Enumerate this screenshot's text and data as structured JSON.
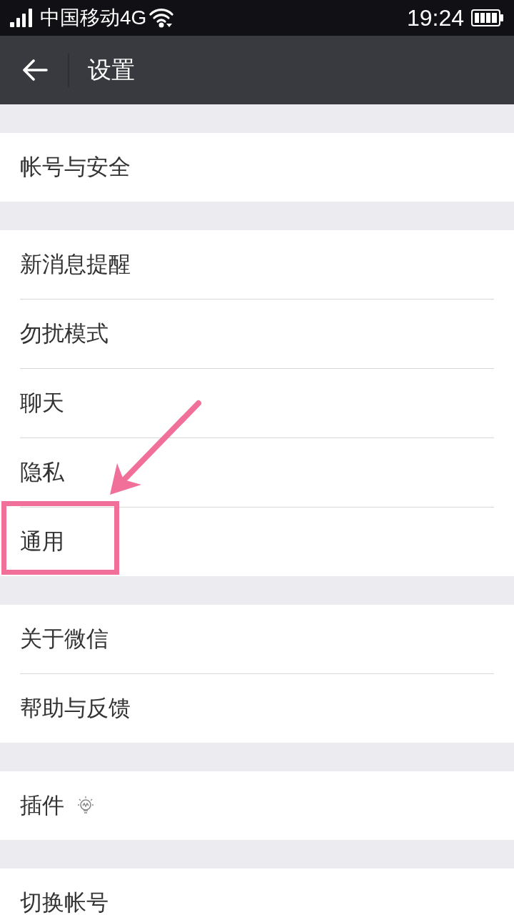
{
  "status_bar": {
    "carrier": "中国移动4G",
    "time": "19:24"
  },
  "header": {
    "title": "设置"
  },
  "groups": [
    {
      "items": [
        {
          "label": "帐号与安全",
          "kind": "plain",
          "highlighted": false
        }
      ]
    },
    {
      "items": [
        {
          "label": "新消息提醒",
          "kind": "plain",
          "highlighted": false
        },
        {
          "label": "勿扰模式",
          "kind": "plain",
          "highlighted": false
        },
        {
          "label": "聊天",
          "kind": "plain",
          "highlighted": false
        },
        {
          "label": "隐私",
          "kind": "plain",
          "highlighted": false
        },
        {
          "label": "通用",
          "kind": "plain",
          "highlighted": true
        }
      ]
    },
    {
      "items": [
        {
          "label": "关于微信",
          "kind": "plain",
          "highlighted": false
        },
        {
          "label": "帮助与反馈",
          "kind": "plain",
          "highlighted": false
        }
      ]
    },
    {
      "items": [
        {
          "label": "插件",
          "kind": "bulb",
          "highlighted": false
        }
      ]
    },
    {
      "items": [
        {
          "label": "切换帐号",
          "kind": "plain",
          "highlighted": false
        }
      ]
    }
  ]
}
